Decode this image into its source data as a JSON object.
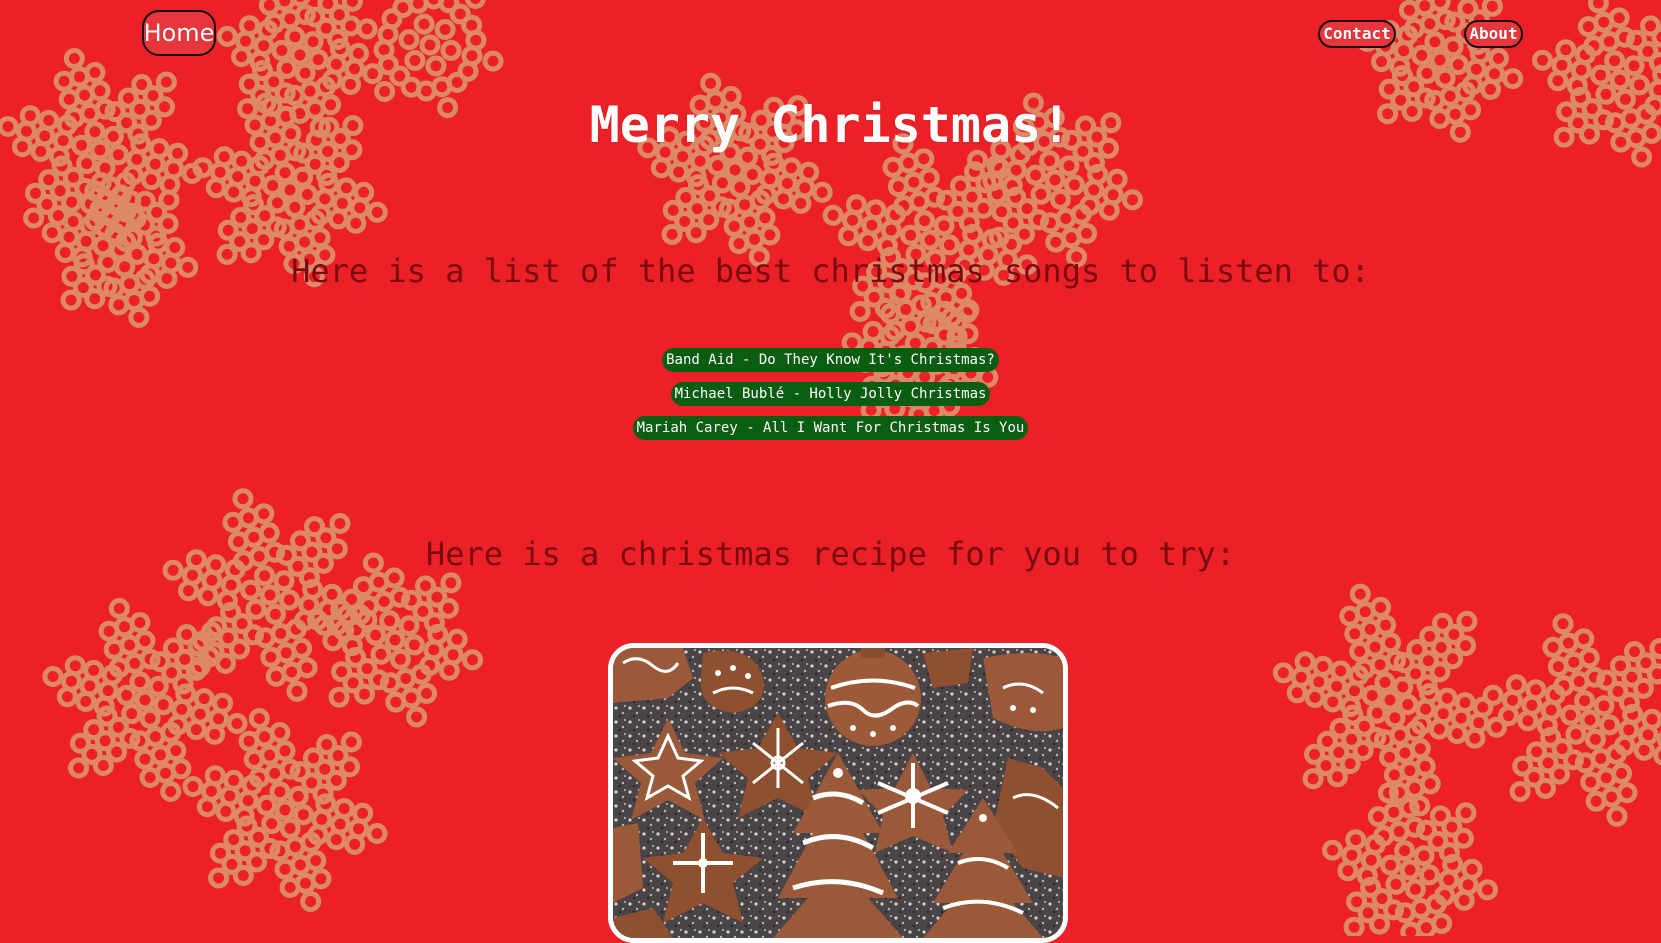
{
  "nav": {
    "home_label": "Home",
    "contact_label": "Contact",
    "about_label": "About"
  },
  "main": {
    "title": "Merry Christmas!",
    "songs_heading": "Here is a list of the best christmas songs to listen to:",
    "songs": [
      "Band Aid - Do They Know It's Christmas?",
      "Michael Bublé - Holly Jolly Christmas",
      "Mariah Carey - All I Want For Christmas Is You"
    ],
    "recipe_heading": "Here is a christmas recipe for you to try:"
  },
  "colors": {
    "background": "#ec2127",
    "snowflake": "#d9a77a",
    "song_button": "#0b5d12",
    "heading_dark": "#7a0a10",
    "cookie": "#9a5a3a",
    "icing": "#ffffff"
  },
  "icons": {
    "background_pattern": "cereal-snowflake-pattern",
    "recipe_image": "gingerbread-cookies-image"
  }
}
